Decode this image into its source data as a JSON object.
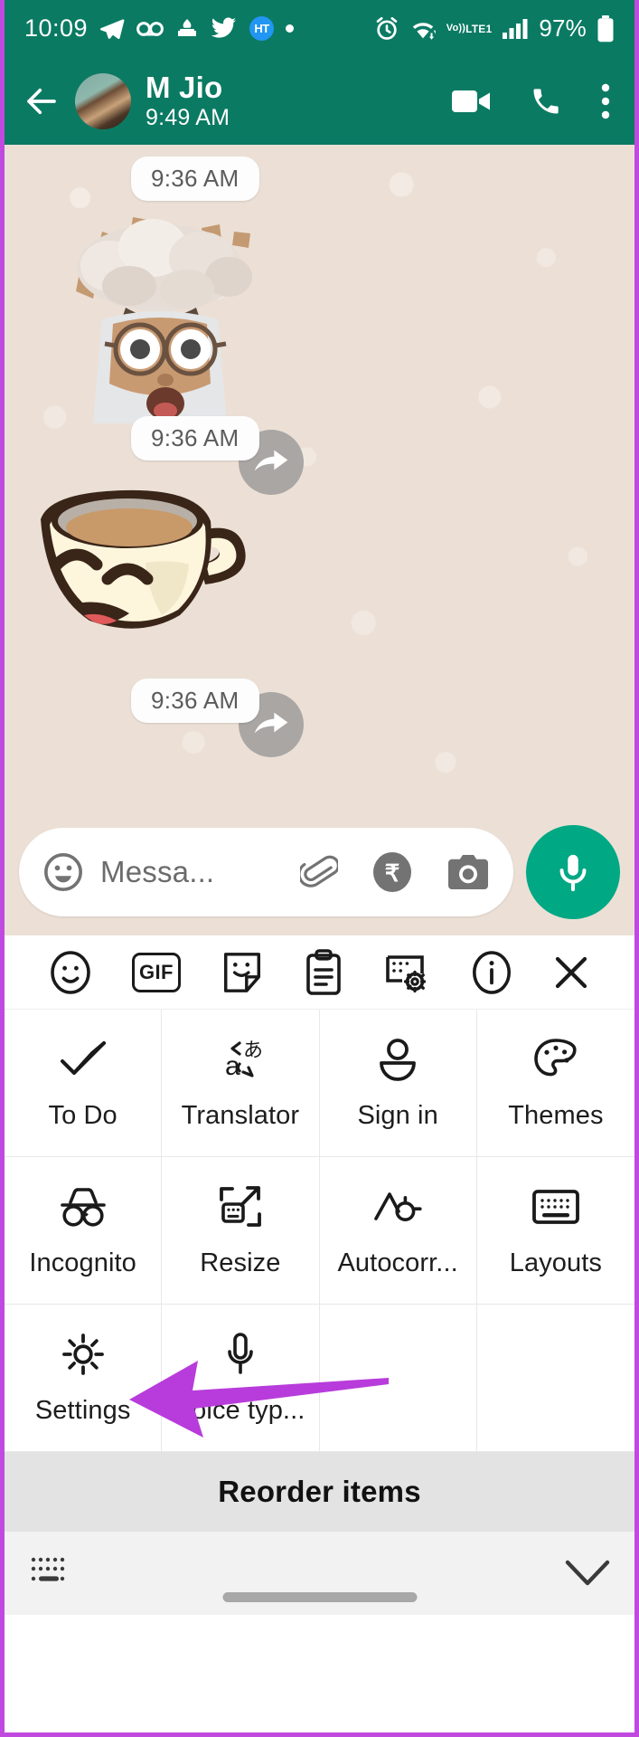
{
  "status_bar": {
    "clock": "10:09",
    "battery_percent": "97%",
    "network_label_top": "Vo))",
    "network_label_bottom": "LTE1",
    "badge_text": "HT",
    "left_icons": [
      "telegram-icon",
      "voicemail-icon",
      "mosque-app-icon",
      "twitter-icon",
      "ht-news-badge",
      "notification-dot-icon"
    ],
    "right_icons": [
      "alarm-icon",
      "wifi-icon",
      "volte-icon",
      "signal-bars-icon",
      "battery-icon"
    ]
  },
  "app_header": {
    "contact_name": "M Jio",
    "status_text": "9:49 AM",
    "back_icon": "back-arrow-icon",
    "actions": [
      "video-call-icon",
      "voice-call-icon",
      "overflow-menu-icon"
    ]
  },
  "chat": {
    "messages": [
      {
        "timestamp": "9:36 AM",
        "sticker": "mind-blown-memoji-sticker",
        "forward_icon": "forward-icon"
      },
      {
        "timestamp": "9:36 AM",
        "sticker": "smiling-coffee-cup-sticker",
        "forward_icon": "forward-icon"
      },
      {
        "timestamp": "9:36 AM"
      }
    ]
  },
  "composer": {
    "placeholder": "Messa...",
    "emoji_icon": "emoji-icon",
    "attach_icon": "attachment-clip-icon",
    "payment_icon": "rupee-payment-icon",
    "camera_icon": "camera-icon",
    "mic_icon": "microphone-icon"
  },
  "keyboard": {
    "toolbar": [
      {
        "name": "emoji-icon",
        "label": "Emoji"
      },
      {
        "name": "gif-icon",
        "label": "GIF"
      },
      {
        "name": "sticker-icon",
        "label": "Sticker"
      },
      {
        "name": "clipboard-icon",
        "label": "Clipboard"
      },
      {
        "name": "keyboard-settings-icon",
        "label": "Keyboard settings"
      },
      {
        "name": "info-icon",
        "label": "Info"
      },
      {
        "name": "close-icon",
        "label": "Close"
      }
    ],
    "grid_items": [
      {
        "label": "To Do",
        "icon": "todo-check-icon"
      },
      {
        "label": "Translator",
        "icon": "translate-icon"
      },
      {
        "label": "Sign in",
        "icon": "person-icon"
      },
      {
        "label": "Themes",
        "icon": "palette-icon"
      },
      {
        "label": "Incognito",
        "icon": "incognito-icon"
      },
      {
        "label": "Resize",
        "icon": "resize-icon"
      },
      {
        "label": "Autocorr...",
        "icon": "autocorrect-icon"
      },
      {
        "label": "Layouts",
        "icon": "keyboard-layouts-icon"
      },
      {
        "label": "Settings",
        "icon": "gear-icon"
      },
      {
        "label": "Voice typ...",
        "icon": "microphone-icon"
      }
    ],
    "reorder_label": "Reorder items",
    "nav_keyboard_icon": "mini-keyboard-icon",
    "nav_collapse_icon": "chevron-down-icon"
  },
  "annotation": {
    "arrow_color": "#b83cdb",
    "points_to": "Settings"
  },
  "colors": {
    "header_green": "#0b7a63",
    "chat_background": "#ece0d6",
    "accent_green": "#00a884",
    "frame_purple": "#c04ae0",
    "reorder_gray": "#e3e3e3"
  }
}
